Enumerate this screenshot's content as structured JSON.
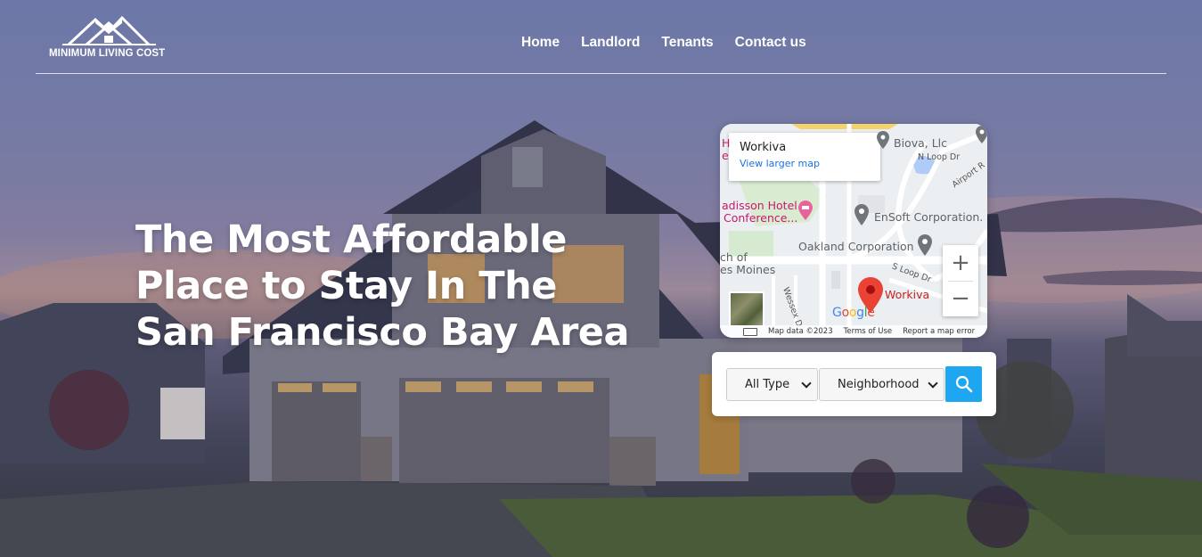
{
  "logo": {
    "text": "MINIMUM LIVING COST"
  },
  "nav": {
    "items": [
      "Home",
      "Landlord",
      "Tenants",
      "Contact us"
    ]
  },
  "hero": {
    "headline_lines": [
      "The Most Affordable",
      "Place to Stay In The",
      "San Francisco Bay Area"
    ]
  },
  "map": {
    "place_name": "Workiva",
    "view_larger": "View larger map",
    "labels": {
      "biova": "Biova, Llc",
      "n_loop": "N Loop Dr",
      "airport": "Airport R",
      "radisson_1": "adisson Hotel",
      "radisson_2": "Conference...",
      "ensoft": "EnSoft Corporation.",
      "oakland": "Oakland Corporation",
      "church_1": "ch of",
      "church_2": "es Moines",
      "s_loop": "S Loop Dr",
      "workiva_pin": "Workiva",
      "wessex": "Wessex D",
      "h": "H",
      "e": "e"
    },
    "zoom_in": "+",
    "zoom_out": "−",
    "google": "Google",
    "attribution": {
      "map_data": "Map data ©2023",
      "terms": "Terms of Use",
      "report": "Report a map error"
    }
  },
  "search": {
    "type_value": "All Type",
    "neighborhood_value": "Neighborhood"
  },
  "colors": {
    "accent": "#1ea7f0",
    "map_link": "#1a73e8",
    "pin_red": "#ea4335"
  }
}
